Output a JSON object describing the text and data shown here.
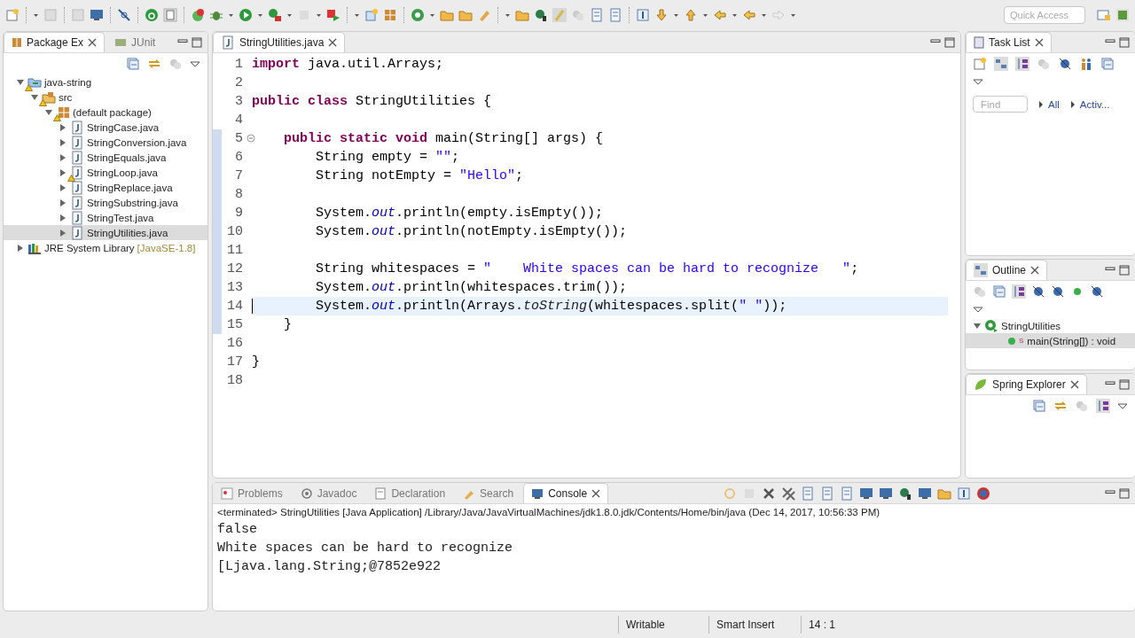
{
  "toolbar": {
    "quick_access": {
      "placeholder": "Quick Access"
    }
  },
  "package_explorer": {
    "tabs": [
      {
        "label": "Package Ex",
        "selected": true
      },
      {
        "label": "JUnit",
        "selected": false
      }
    ],
    "tree": [
      {
        "kind": "project",
        "label": "java-string",
        "warning": true,
        "expanded": true,
        "selected": false,
        "children": [
          {
            "kind": "source_folder",
            "label": "src",
            "warning": true,
            "expanded": true,
            "selected": false,
            "children": [
              {
                "kind": "package",
                "label": "(default package)",
                "warning": true,
                "expanded": true,
                "selected": false,
                "children": [
                  {
                    "kind": "java_file",
                    "label": "StringCase.java",
                    "warning": false,
                    "expanded": false,
                    "selected": false
                  },
                  {
                    "kind": "java_file",
                    "label": "StringConversion.java",
                    "warning": false,
                    "expanded": false,
                    "selected": false
                  },
                  {
                    "kind": "java_file",
                    "label": "StringEquals.java",
                    "warning": false,
                    "expanded": false,
                    "selected": false
                  },
                  {
                    "kind": "java_file",
                    "label": "StringLoop.java",
                    "warning": true,
                    "expanded": false,
                    "selected": false
                  },
                  {
                    "kind": "java_file",
                    "label": "StringReplace.java",
                    "warning": false,
                    "expanded": false,
                    "selected": false
                  },
                  {
                    "kind": "java_file",
                    "label": "StringSubstring.java",
                    "warning": false,
                    "expanded": false,
                    "selected": false
                  },
                  {
                    "kind": "java_file",
                    "label": "StringTest.java",
                    "warning": false,
                    "expanded": false,
                    "selected": false
                  },
                  {
                    "kind": "java_file",
                    "label": "StringUtilities.java",
                    "warning": false,
                    "expanded": false,
                    "selected": true
                  }
                ]
              }
            ]
          }
        ]
      },
      {
        "kind": "library",
        "label": "JRE System Library",
        "decoration": "[JavaSE-1.8]",
        "warning": false,
        "expanded": false,
        "selected": false
      }
    ]
  },
  "editor": {
    "tabs": [
      {
        "label": "StringUtilities.java",
        "selected": true
      }
    ],
    "lines": [
      {
        "number": "1",
        "in_range": false,
        "current": false,
        "foldable": false,
        "tokens": [
          {
            "kind": "keyword",
            "text": "import"
          },
          {
            "kind": "plain",
            "text": " java.util.Arrays;"
          }
        ]
      },
      {
        "number": "2",
        "in_range": false,
        "current": false,
        "foldable": false
      },
      {
        "number": "3",
        "in_range": false,
        "current": false,
        "foldable": false,
        "tokens": [
          {
            "kind": "keyword",
            "text": "public class"
          },
          {
            "kind": "plain",
            "text": " StringUtilities {"
          }
        ]
      },
      {
        "number": "4",
        "in_range": false,
        "current": false,
        "foldable": false
      },
      {
        "number": "5",
        "in_range": true,
        "current": false,
        "foldable": true,
        "tokens": [
          {
            "kind": "keyword",
            "text": "    public static void"
          },
          {
            "kind": "plain",
            "text": " main(String[] args) {"
          }
        ]
      },
      {
        "number": "6",
        "in_range": true,
        "current": false,
        "foldable": false,
        "tokens": [
          {
            "kind": "plain",
            "text": "        String empty = "
          },
          {
            "kind": "string",
            "text": "\"\""
          },
          {
            "kind": "plain",
            "text": ";"
          }
        ]
      },
      {
        "number": "7",
        "in_range": true,
        "current": false,
        "foldable": false,
        "tokens": [
          {
            "kind": "plain",
            "text": "        String notEmpty = "
          },
          {
            "kind": "string",
            "text": "\"Hello\""
          },
          {
            "kind": "plain",
            "text": ";"
          }
        ]
      },
      {
        "number": "8",
        "in_range": true,
        "current": false,
        "foldable": false
      },
      {
        "number": "9",
        "in_range": true,
        "current": false,
        "foldable": false,
        "tokens": [
          {
            "kind": "plain",
            "text": "        System."
          },
          {
            "kind": "field",
            "text": "out"
          },
          {
            "kind": "plain",
            "text": ".println(empty.isEmpty());"
          }
        ]
      },
      {
        "number": "10",
        "in_range": true,
        "current": false,
        "foldable": false,
        "tokens": [
          {
            "kind": "plain",
            "text": "        System."
          },
          {
            "kind": "field",
            "text": "out"
          },
          {
            "kind": "plain",
            "text": ".println(notEmpty.isEmpty());"
          }
        ]
      },
      {
        "number": "11",
        "in_range": true,
        "current": false,
        "foldable": false
      },
      {
        "number": "12",
        "in_range": true,
        "current": false,
        "foldable": false,
        "tokens": [
          {
            "kind": "plain",
            "text": "        String whitespaces = "
          },
          {
            "kind": "string",
            "text": "\"    White spaces can be hard to recognize   \""
          },
          {
            "kind": "plain",
            "text": ";"
          }
        ]
      },
      {
        "number": "13",
        "in_range": true,
        "current": false,
        "foldable": false,
        "tokens": [
          {
            "kind": "plain",
            "text": "        System."
          },
          {
            "kind": "field",
            "text": "out"
          },
          {
            "kind": "plain",
            "text": ".println(whitespaces.trim());"
          }
        ]
      },
      {
        "number": "14",
        "in_range": true,
        "current": true,
        "foldable": false,
        "tokens": [
          {
            "kind": "plain",
            "text": "        System."
          },
          {
            "kind": "field",
            "text": "out"
          },
          {
            "kind": "plain",
            "text": ".println(Arrays."
          },
          {
            "kind": "static_method",
            "text": "toString"
          },
          {
            "kind": "plain",
            "text": "(whitespaces.split("
          },
          {
            "kind": "string",
            "text": "\" \""
          },
          {
            "kind": "plain",
            "text": "));"
          }
        ]
      },
      {
        "number": "15",
        "in_range": true,
        "current": false,
        "foldable": false,
        "tokens": [
          {
            "kind": "plain",
            "text": "    }"
          }
        ]
      },
      {
        "number": "16",
        "in_range": false,
        "current": false,
        "foldable": false
      },
      {
        "number": "17",
        "in_range": false,
        "current": false,
        "foldable": false,
        "tokens": [
          {
            "kind": "plain",
            "text": "}"
          }
        ]
      },
      {
        "number": "18",
        "in_range": false,
        "current": false,
        "foldable": false
      }
    ]
  },
  "task_list": {
    "title": "Task List",
    "find": {
      "placeholder": "Find"
    },
    "links": [
      "All",
      "Activ..."
    ]
  },
  "outline": {
    "title": "Outline",
    "tree": [
      {
        "kind": "class",
        "label": "StringUtilities",
        "expanded": true,
        "selected": false,
        "children": [
          {
            "kind": "method",
            "label": "main(String[]) : void",
            "badge": "S",
            "selected": true
          }
        ]
      }
    ]
  },
  "spring_explorer": {
    "title": "Spring Explorer"
  },
  "console": {
    "tabs": [
      {
        "kind": "problems",
        "label": "Problems",
        "selected": false
      },
      {
        "kind": "javadoc",
        "label": "Javadoc",
        "selected": false
      },
      {
        "kind": "declaration",
        "label": "Declaration",
        "selected": false
      },
      {
        "kind": "search",
        "label": "Search",
        "selected": false
      },
      {
        "kind": "console",
        "label": "Console",
        "selected": true
      }
    ],
    "header": "<terminated> StringUtilities [Java Application] /Library/Java/JavaVirtualMachines/jdk1.8.0.jdk/Contents/Home/bin/java (Dec 14, 2017, 10:56:33 PM)",
    "output": [
      "false",
      "White spaces can be hard to recognize",
      "[Ljava.lang.String;@7852e922"
    ]
  },
  "status_bar": [
    "Writable",
    "Smart Insert",
    "14 : 1"
  ]
}
